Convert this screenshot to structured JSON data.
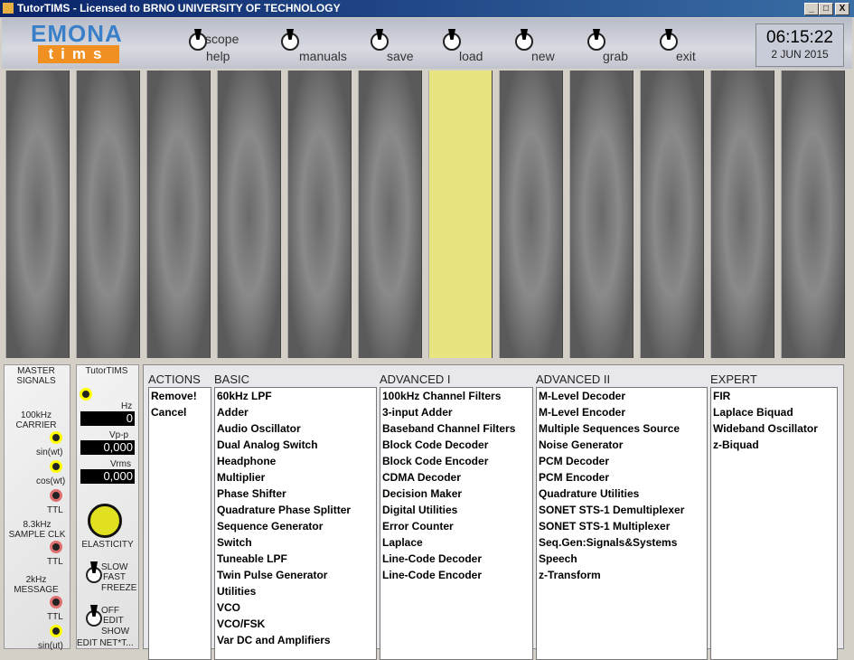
{
  "window": {
    "title": "TutorTIMS - Licensed to BRNO UNIVERSITY OF TECHNOLOGY",
    "min": "_",
    "max": "□",
    "close": "X"
  },
  "logo": {
    "top": "EMONA",
    "bottom": "tims"
  },
  "toolbar": {
    "scope": "scope",
    "help": "help",
    "manuals": "manuals",
    "save": "save",
    "load": "load",
    "new": "new",
    "grab": "grab",
    "exit": "exit"
  },
  "clock": {
    "time": "06:15:22",
    "date": "2 JUN 2015"
  },
  "master": {
    "title1": "MASTER",
    "title2": "SIGNALS",
    "c1": "100kHz",
    "c2": "CARRIER",
    "sin": "sin(wt)",
    "cos": "cos(wt)",
    "ttl": "TTL",
    "s1": "8.3kHz",
    "s2": "SAMPLE CLK",
    "m1": "2kHz",
    "m2": "MESSAGE",
    "sinut": "sin(ut)"
  },
  "tutor": {
    "title": "TutorTIMS",
    "hz_label": "Hz",
    "hz": "0",
    "vpp_label": "Vp-p",
    "vpp": "0,000",
    "vrms_label": "Vrms",
    "vrms": "0,000",
    "elasticity": "ELASTICITY",
    "slow": "SLOW",
    "fast": "FAST",
    "freeze": "FREEZE",
    "off": "OFF",
    "edit": "EDIT",
    "show": "SHOW",
    "editnet": "EDIT NET*T..."
  },
  "columns": {
    "actions": {
      "title": "ACTIONS",
      "items": [
        "Remove!",
        "Cancel"
      ]
    },
    "basic": {
      "title": "BASIC",
      "items": [
        "60kHz LPF",
        "Adder",
        "Audio Oscillator",
        "Dual Analog Switch",
        "Headphone",
        "Multiplier",
        "Phase Shifter",
        "Quadrature Phase Splitter",
        "Sequence Generator",
        "Switch",
        "Tuneable LPF",
        "Twin Pulse Generator",
        "Utilities",
        "VCO",
        "VCO/FSK",
        "Var DC and Amplifiers"
      ]
    },
    "adv1": {
      "title": "ADVANCED I",
      "items": [
        "100kHz Channel Filters",
        "3-input Adder",
        "Baseband Channel Filters",
        "Block Code Decoder",
        "Block Code Encoder",
        "CDMA Decoder",
        "Decision Maker",
        "Digital Utilities",
        "Error Counter",
        "Laplace",
        "Line-Code Decoder",
        "Line-Code Encoder"
      ]
    },
    "adv2": {
      "title": "ADVANCED II",
      "items": [
        "M-Level Decoder",
        "M-Level Encoder",
        "Multiple Sequences Source",
        "Noise Generator",
        "PCM Decoder",
        "PCM Encoder",
        "Quadrature Utilities",
        "SONET STS-1 Demultiplexer",
        "SONET STS-1 Multiplexer",
        "Seq.Gen:Signals&Systems",
        "Speech",
        "z-Transform"
      ]
    },
    "expert": {
      "title": "EXPERT",
      "items": [
        "FIR",
        "Laplace Biquad",
        "Wideband Oscillator",
        "z-Biquad"
      ]
    }
  },
  "slots": {
    "count": 12,
    "selected_index": 6,
    "selected_color": "#e8e480"
  }
}
